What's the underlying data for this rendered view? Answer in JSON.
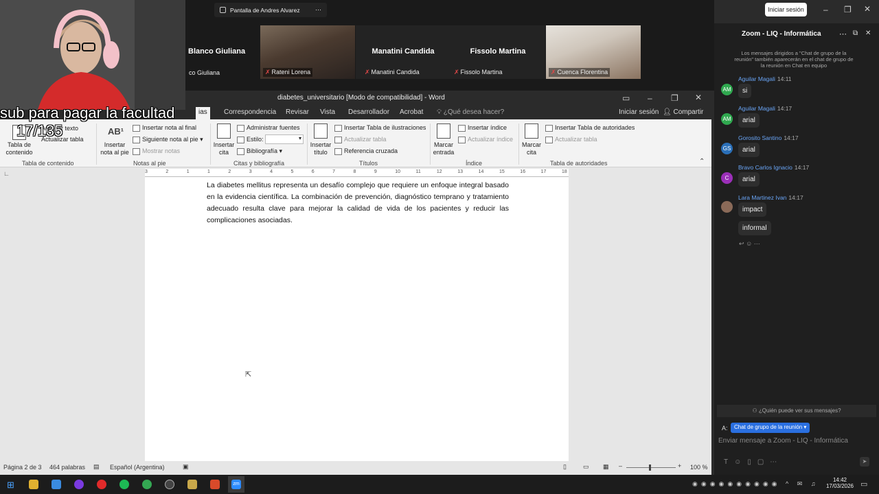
{
  "zoom": {
    "share_label": "Pantalla de Andres Alvarez",
    "login_button": "Iniciar sesión",
    "participants": [
      {
        "name": "Blanco Giuliana",
        "label": "co Giuliana",
        "video": false
      },
      {
        "name": "",
        "label": "Rateni Lorena",
        "video": true
      },
      {
        "name": "Manatini Candida",
        "label": "Manatini Candida",
        "video": false
      },
      {
        "name": "Fissolo Martina",
        "label": "Fissolo Martina",
        "video": false
      },
      {
        "name": "",
        "label": "Cuenca Florentina",
        "video": true
      }
    ]
  },
  "overlay": {
    "line1": "sub para pagar la facultad",
    "line2": "17/135"
  },
  "word": {
    "title": "diabetes_universitario [Modo de compatibilidad] - Word",
    "tabs": [
      "ias",
      "Correspondencia",
      "Revisar",
      "Vista",
      "Desarrollador",
      "Acrobat"
    ],
    "tell_me": "¿Qué desea hacer?",
    "signin": "Iniciar sesión",
    "share": "Compartir",
    "ribbon": {
      "toc": {
        "add_text": "Agregar texto",
        "update": "Actualizar tabla",
        "label": "Tabla de contenido",
        "group": "Tabla de contenido"
      },
      "foot": {
        "insert_big": "Insertar nota al pie",
        "insert_end": "Insertar nota al final",
        "next": "Siguiente nota al pie",
        "show": "Mostrar notas",
        "group": "Notas al pie"
      },
      "cit": {
        "insert": "Insertar cita",
        "manage": "Administrar fuentes",
        "style_label": "Estilo:",
        "bib": "Bibliografía",
        "group": "Citas y bibliografía"
      },
      "cap": {
        "insert": "Insertar título",
        "table_ill": "Insertar Tabla de ilustraciones",
        "update": "Actualizar tabla",
        "cross": "Referencia cruzada",
        "group": "Títulos"
      },
      "idx": {
        "mark": "Marcar entrada",
        "insert": "Insertar índice",
        "update": "Actualizar índice",
        "group": "Índice"
      },
      "auth": {
        "mark": "Marcar cita",
        "insert": "Insertar Tabla de autoridades",
        "update": "Actualizar tabla",
        "group": "Tabla de autoridades"
      }
    },
    "ruler_ticks": [
      "3",
      "2",
      "1",
      "1",
      "2",
      "3",
      "4",
      "5",
      "6",
      "7",
      "8",
      "9",
      "10",
      "11",
      "12",
      "13",
      "14",
      "15",
      "16",
      "17",
      "18"
    ],
    "doc_text": "La diabetes mellitus representa un desafío complejo que requiere un enfoque integral basado en la evidencia científica. La combinación de prevención, diagnóstico temprano y tratamiento adecuado resulta clave para mejorar la calidad de vida de los pacientes y reducir las complicaciones asociadas.",
    "status": {
      "page": "Página 2 de 3",
      "words": "464 palabras",
      "lang": "Español (Argentina)",
      "zoom": "100 %"
    }
  },
  "chat": {
    "title": "Zoom - LIQ - Informática",
    "notice": "Los mensajes dirigidos a \"Chat de grupo de la reunión\" también aparecerán en el chat de grupo de la reunión en Chat en equipo",
    "messages": [
      {
        "initials": "AM",
        "color": "#2fa84f",
        "name": "Aguilar Magali",
        "time": "14:11",
        "text": "si"
      },
      {
        "initials": "AM",
        "color": "#2fa84f",
        "name": "Aguilar Magali",
        "time": "14:17",
        "text": "arial"
      },
      {
        "initials": "GS",
        "color": "#2a6fb8",
        "name": "Gorosito Santino",
        "time": "14:17",
        "text": "arial"
      },
      {
        "initials": "C",
        "color": "#9b2fb8",
        "name": "Bravo Carlos Ignacio",
        "time": "14:17",
        "text": "arial"
      },
      {
        "initials": "",
        "color": "#8a6a58",
        "name": "Lara Martinez Ivan",
        "time": "14:17",
        "text": "impact"
      },
      {
        "initials": "",
        "color": "",
        "name": "",
        "time": "",
        "text": "informal"
      }
    ],
    "who_can_see": "¿Quién puede ver sus mensajes?",
    "to_label": "A:",
    "recipient": "Chat de grupo de la reunión",
    "input_placeholder": "Enviar mensaje a Zoom - LIQ - Informática"
  },
  "taskbar": {
    "time": "14:42",
    "date": "17/03/2026"
  }
}
